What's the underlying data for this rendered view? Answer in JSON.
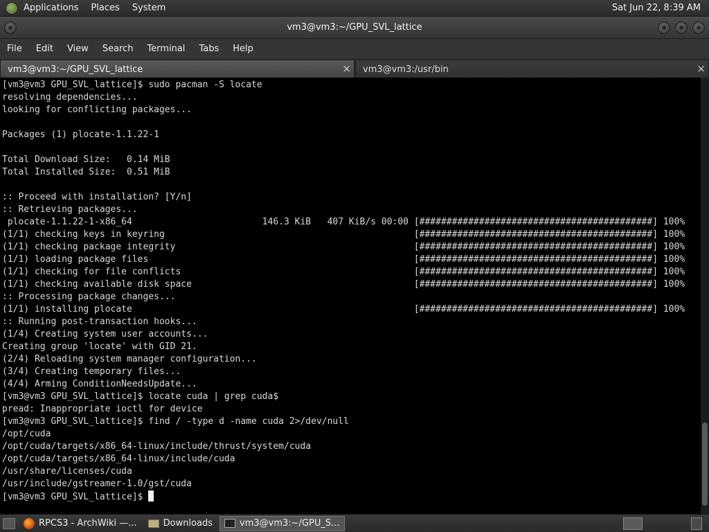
{
  "top_panel": {
    "menus": [
      "Applications",
      "Places",
      "System"
    ],
    "clock": "Sat Jun 22,  8:39 AM"
  },
  "window": {
    "title": "vm3@vm3:~/GPU_SVL_lattice"
  },
  "menubar": [
    "File",
    "Edit",
    "View",
    "Search",
    "Terminal",
    "Tabs",
    "Help"
  ],
  "tabs": [
    {
      "label": "vm3@vm3:~/GPU_SVL_lattice",
      "close": "×"
    },
    {
      "label": "vm3@vm3:/usr/bin",
      "close": "×"
    }
  ],
  "terminal": {
    "lines": [
      "[vm3@vm3 GPU_SVL_lattice]$ sudo pacman -S locate",
      "resolving dependencies...",
      "looking for conflicting packages...",
      "",
      "Packages (1) plocate-1.1.22-1",
      "",
      "Total Download Size:   0.14 MiB",
      "Total Installed Size:  0.51 MiB",
      "",
      ":: Proceed with installation? [Y/n]",
      ":: Retrieving packages...",
      " plocate-1.1.22-1-x86_64                        146.3 KiB   407 KiB/s 00:00 [###########################################] 100%",
      "(1/1) checking keys in keyring                                              [###########################################] 100%",
      "(1/1) checking package integrity                                            [###########################################] 100%",
      "(1/1) loading package files                                                 [###########################################] 100%",
      "(1/1) checking for file conflicts                                           [###########################################] 100%",
      "(1/1) checking available disk space                                         [###########################################] 100%",
      ":: Processing package changes...",
      "(1/1) installing plocate                                                    [###########################################] 100%",
      ":: Running post-transaction hooks...",
      "(1/4) Creating system user accounts...",
      "Creating group 'locate' with GID 21.",
      "(2/4) Reloading system manager configuration...",
      "(3/4) Creating temporary files...",
      "(4/4) Arming ConditionNeedsUpdate...",
      "[vm3@vm3 GPU_SVL_lattice]$ locate cuda | grep cuda$",
      "pread: Inappropriate ioctl for device",
      "[vm3@vm3 GPU_SVL_lattice]$ find / -type d -name cuda 2>/dev/null",
      "/opt/cuda",
      "/opt/cuda/targets/x86_64-linux/include/thrust/system/cuda",
      "/opt/cuda/targets/x86_64-linux/include/cuda",
      "/usr/share/licenses/cuda",
      "/usr/include/gstreamer-1.0/gst/cuda"
    ],
    "prompt": "[vm3@vm3 GPU_SVL_lattice]$ "
  },
  "taskbar": {
    "items": [
      "RPCS3 - ArchWiki —...",
      "Downloads",
      "vm3@vm3:~/GPU_S..."
    ]
  },
  "colors": {
    "terminal_bg": "#000000",
    "terminal_fg": "#d8d8d8",
    "panel_bg": "#353535"
  }
}
